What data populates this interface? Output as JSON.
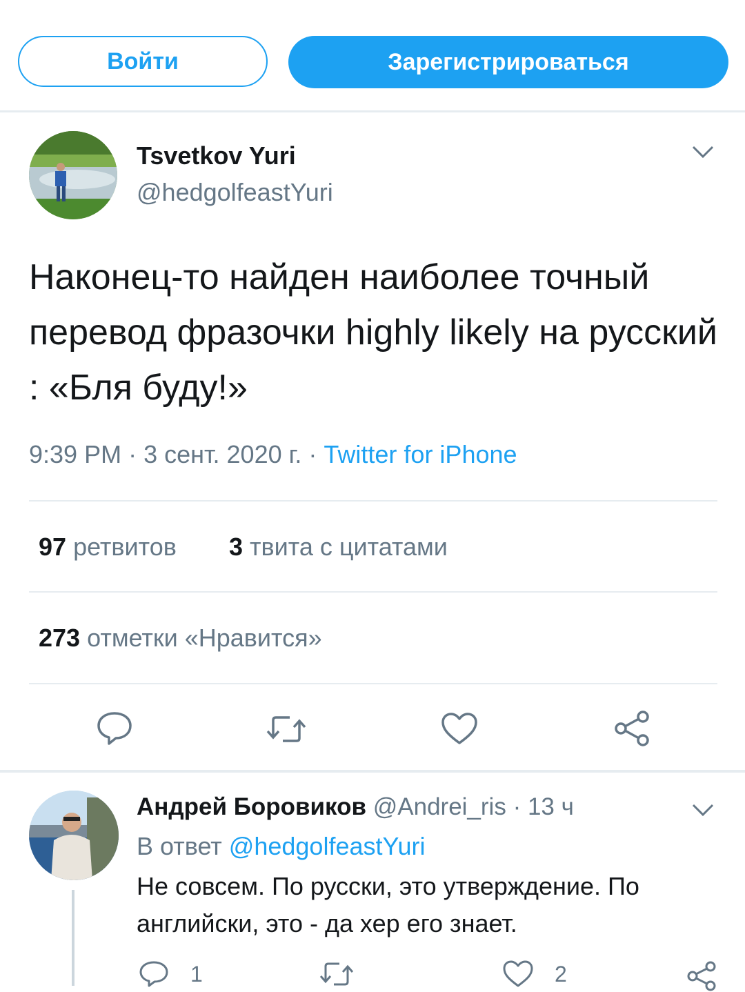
{
  "header": {
    "login_label": "Войти",
    "signup_label": "Зарегистрироваться"
  },
  "tweet": {
    "author_name": "Tsvetkov Yuri",
    "author_handle": "@hedgolfeastYuri",
    "text": "Наконец-то найден наиболее точный перевод фразочки highly likely на русский : «Бля буду!»",
    "time": "9:39 PM",
    "separator": "·",
    "date": "3 сент. 2020 г.",
    "source": "Twitter for iPhone",
    "retweets_count": "97",
    "retweets_label": "ретвитов",
    "quotes_count": "3",
    "quotes_label": "твита с цитатами",
    "likes_count": "273",
    "likes_label": "отметки «Нравится»"
  },
  "reply": {
    "author_name": "Андрей Боровиков",
    "author_handle": "@Andrei_ris",
    "separator": "·",
    "time": "13 ч",
    "reply_prefix": "В ответ",
    "reply_mention": "@hedgolfeastYuri",
    "text": "Не совсем. По русски, это утверждение.  По английски, это - да хер его знает.",
    "reply_count": "1",
    "like_count": "2"
  },
  "icons": [
    "chevron-down-icon",
    "reply-icon",
    "retweet-icon",
    "like-icon",
    "share-icon"
  ],
  "colors": {
    "accent": "#1da1f2",
    "secondary_text": "#657786",
    "divider": "#e6ecf0",
    "icon": "#657786"
  }
}
